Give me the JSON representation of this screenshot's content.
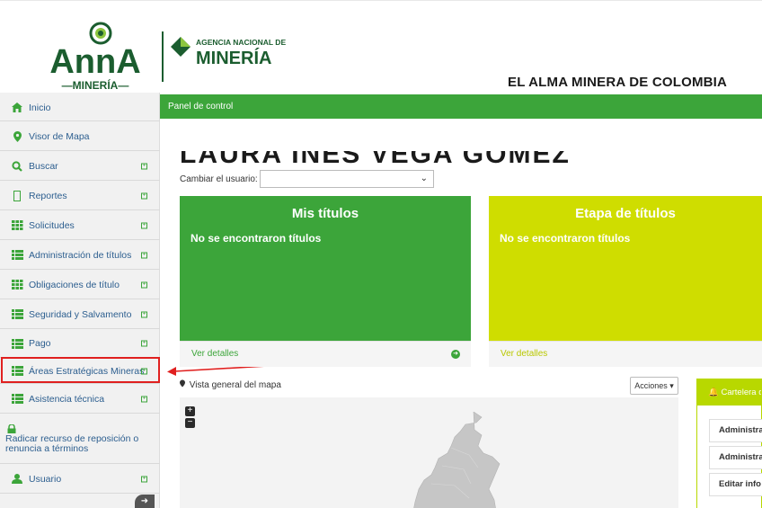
{
  "header": {
    "logo_anna_main": "AnnA",
    "logo_anna_sub": "—MINERÍA—",
    "logo_agencia_line1": "AGENCIA NACIONAL DE",
    "logo_agencia_line2": "MINERÍA",
    "tagline": "EL ALMA MINERA DE COLOMBIA"
  },
  "sidebar": {
    "items": [
      {
        "label": "Inicio",
        "icon": "home-icon",
        "expandable": false
      },
      {
        "label": "Visor de Mapa",
        "icon": "map-marker-icon",
        "expandable": false
      },
      {
        "label": "Buscar",
        "icon": "search-icon",
        "expandable": true
      },
      {
        "label": "Reportes",
        "icon": "document-icon",
        "expandable": true
      },
      {
        "label": "Solicitudes",
        "icon": "grid-icon",
        "expandable": true
      },
      {
        "label": "Administración de títulos",
        "icon": "list-icon",
        "expandable": true
      },
      {
        "label": "Obligaciones de título",
        "icon": "grid-icon",
        "expandable": true
      },
      {
        "label": "Seguridad y Salvamento",
        "icon": "list-icon",
        "expandable": true
      },
      {
        "label": "Pago",
        "icon": "list-icon",
        "expandable": true
      },
      {
        "label": "Áreas Estratégicas Mineras",
        "icon": "list-icon",
        "expandable": true
      },
      {
        "label": "Asistencia técnica",
        "icon": "list-icon",
        "expandable": true
      },
      {
        "label": "Radicar recurso de reposición o renuncia a términos",
        "icon": "lock-icon",
        "expandable": false
      },
      {
        "label": "Usuario",
        "icon": "user-icon",
        "expandable": true
      }
    ],
    "highlighted_item": "Áreas Estratégicas Mineras"
  },
  "topbar": {
    "title": "Panel de control"
  },
  "main": {
    "username": "LAURA INÉS VEGA GÓMEZ",
    "change_user_label": "Cambiar el usuario:",
    "change_user_value": "",
    "cards": [
      {
        "title": "Mis títulos",
        "message": "No se encontraron títulos",
        "footer": "Ver detalles",
        "color": "#3ca53a"
      },
      {
        "title": "Etapa de títulos",
        "message": "No se encontraron títulos",
        "footer": "Ver detalles",
        "color": "#cfdd00"
      }
    ],
    "map": {
      "label": "Vista general del mapa",
      "actions_label": "Acciones",
      "zoom_in": "+",
      "zoom_out": "−"
    },
    "cartelera": {
      "title": "Cartelera de",
      "items": [
        "Administra",
        "Administra",
        "Editar info"
      ]
    }
  },
  "colors": {
    "primary_green": "#3ca53a",
    "lime": "#cfdd00",
    "highlight_red": "#e0201f",
    "sidebar_bg": "#f1f1f1"
  }
}
